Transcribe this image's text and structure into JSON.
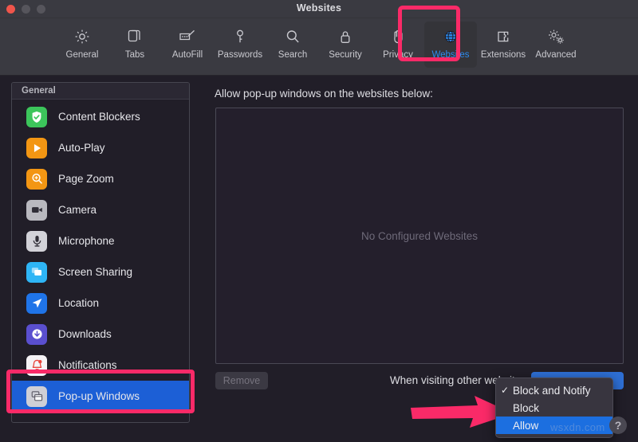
{
  "window": {
    "title": "Websites",
    "traffic_lights": [
      "close",
      "minimize",
      "maximize"
    ]
  },
  "toolbar": {
    "items": [
      {
        "label": "General",
        "icon": "gear-icon",
        "selected": false
      },
      {
        "label": "Tabs",
        "icon": "tabs-icon",
        "selected": false
      },
      {
        "label": "AutoFill",
        "icon": "autofill-icon",
        "selected": false
      },
      {
        "label": "Passwords",
        "icon": "key-icon",
        "selected": false
      },
      {
        "label": "Search",
        "icon": "search-icon",
        "selected": false
      },
      {
        "label": "Security",
        "icon": "lock-icon",
        "selected": false
      },
      {
        "label": "Privacy",
        "icon": "hand-icon",
        "selected": false
      },
      {
        "label": "Websites",
        "icon": "globe-icon",
        "selected": true
      },
      {
        "label": "Extensions",
        "icon": "puzzle-icon",
        "selected": false
      },
      {
        "label": "Advanced",
        "icon": "gears-icon",
        "selected": false
      }
    ],
    "selected_label": "Websites"
  },
  "sidebar": {
    "header": "General",
    "items": [
      {
        "label": "Content Blockers",
        "icon": "shield-check-icon",
        "color": "#3cc55b",
        "selected": false
      },
      {
        "label": "Auto-Play",
        "icon": "play-icon",
        "color": "#f39613",
        "selected": false
      },
      {
        "label": "Page Zoom",
        "icon": "zoom-in-icon",
        "color": "#f39613",
        "selected": false
      },
      {
        "label": "Camera",
        "icon": "camera-icon",
        "color": "#b9b9bf",
        "selected": false
      },
      {
        "label": "Microphone",
        "icon": "microphone-icon",
        "color": "#d2d2d8",
        "selected": false
      },
      {
        "label": "Screen Sharing",
        "icon": "screen-share-icon",
        "color": "#2eb5f5",
        "selected": false
      },
      {
        "label": "Location",
        "icon": "location-icon",
        "color": "#1f74e8",
        "selected": false
      },
      {
        "label": "Downloads",
        "icon": "download-icon",
        "color": "#5a4fcf",
        "selected": false
      },
      {
        "label": "Notifications",
        "icon": "bell-icon",
        "color": "#f5f3f6",
        "selected": false
      },
      {
        "label": "Pop-up Windows",
        "icon": "popup-window-icon",
        "color": "#cfcfd6",
        "selected": true
      }
    ]
  },
  "main": {
    "heading": "Allow pop-up windows on the websites below:",
    "empty_state": "No Configured Websites",
    "remove_label": "Remove",
    "visiting_label": "When visiting other websites",
    "selected_option": "Allow"
  },
  "dropdown": {
    "open": true,
    "items": [
      {
        "label": "Block and Notify",
        "checked": true,
        "highlighted": false
      },
      {
        "label": "Block",
        "checked": false,
        "highlighted": false
      },
      {
        "label": "Allow",
        "checked": false,
        "highlighted": true
      }
    ],
    "check_glyph": "✓"
  },
  "help": {
    "label": "?"
  },
  "watermark": {
    "text": "wsxdn.com"
  },
  "annotations": {
    "highlight_color": "#fa2a68",
    "arrow_target": "Allow",
    "boxes": [
      "websites-toolbar-item",
      "popup-windows-sidebar-item"
    ]
  }
}
